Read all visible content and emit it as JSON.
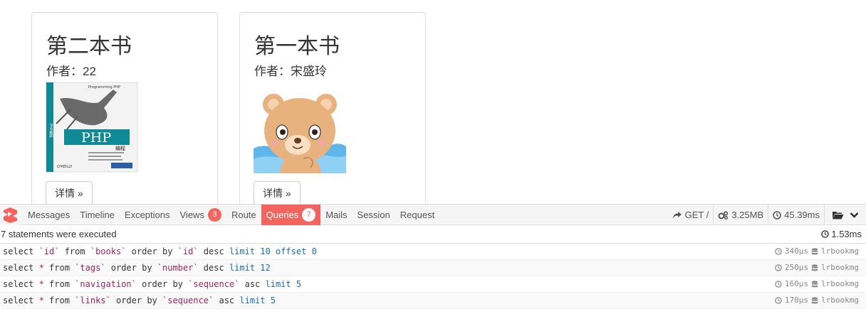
{
  "books": [
    {
      "title": "第二本书",
      "author": "作者：22",
      "button": "详情 »"
    },
    {
      "title": "第一本书",
      "author": "作者：宋盛玲",
      "button": "详情 »"
    }
  ],
  "cover1": {
    "publisher_top": "Programming PHP",
    "publisher_sub": "O'REILLY",
    "title_word": "PHP",
    "title_cn": "编程",
    "side_text": "PHP编程"
  },
  "debugbar": {
    "tabs": [
      {
        "label": "Messages"
      },
      {
        "label": "Timeline"
      },
      {
        "label": "Exceptions"
      },
      {
        "label": "Views",
        "badge": "3"
      },
      {
        "label": "Route"
      },
      {
        "label": "Queries",
        "badge": "7"
      },
      {
        "label": "Mails"
      },
      {
        "label": "Session"
      },
      {
        "label": "Request"
      }
    ],
    "method": "GET /",
    "memory": "3.25MB",
    "time": "45.39ms"
  },
  "queries": {
    "statement_count": "7 statements were executed",
    "total_time": "1.53ms",
    "rows": [
      {
        "parts": [
          [
            "kw",
            "select "
          ],
          [
            "tb",
            "`id`"
          ],
          [
            "kw",
            " from "
          ],
          [
            "tb",
            "`books`"
          ],
          [
            "kw",
            " order by "
          ],
          [
            "tb",
            "`id`"
          ],
          [
            "kw",
            " desc "
          ],
          [
            "num",
            "limit"
          ],
          [
            "kw",
            " "
          ],
          [
            "num",
            "10"
          ],
          [
            "kw",
            " "
          ],
          [
            "num",
            "offset"
          ],
          [
            "kw",
            " "
          ],
          [
            "num",
            "0"
          ]
        ],
        "duration": "340μs",
        "connection": "lrbookmg"
      },
      {
        "parts": [
          [
            "kw",
            "select "
          ],
          [
            "tb",
            "*"
          ],
          [
            "kw",
            " from "
          ],
          [
            "tb",
            "`tags`"
          ],
          [
            "kw",
            " order by "
          ],
          [
            "tb",
            "`number`"
          ],
          [
            "kw",
            " desc "
          ],
          [
            "num",
            "limit"
          ],
          [
            "kw",
            " "
          ],
          [
            "num",
            "12"
          ]
        ],
        "duration": "250μs",
        "connection": "lrbookmg"
      },
      {
        "parts": [
          [
            "kw",
            "select "
          ],
          [
            "tb",
            "*"
          ],
          [
            "kw",
            " from "
          ],
          [
            "tb",
            "`navigation`"
          ],
          [
            "kw",
            " order by "
          ],
          [
            "tb",
            "`sequence`"
          ],
          [
            "kw",
            " asc "
          ],
          [
            "num",
            "limit"
          ],
          [
            "kw",
            " "
          ],
          [
            "num",
            "5"
          ]
        ],
        "duration": "160μs",
        "connection": "lrbookmg"
      },
      {
        "parts": [
          [
            "kw",
            "select "
          ],
          [
            "tb",
            "*"
          ],
          [
            "kw",
            " from "
          ],
          [
            "tb",
            "`links`"
          ],
          [
            "kw",
            " order by "
          ],
          [
            "tb",
            "`sequence`"
          ],
          [
            "kw",
            " asc "
          ],
          [
            "num",
            "limit"
          ],
          [
            "kw",
            " "
          ],
          [
            "num",
            "5"
          ]
        ],
        "duration": "170μs",
        "connection": "lrbookmg"
      }
    ]
  },
  "colors": {
    "accent": "#f4645f",
    "table": "#a0245a",
    "number": "#1a6dae"
  },
  "icons": [
    "laravel-logo-icon",
    "share-icon",
    "cogs-icon",
    "clock-icon",
    "folder-open-icon",
    "chevron-down-icon",
    "database-icon"
  ]
}
